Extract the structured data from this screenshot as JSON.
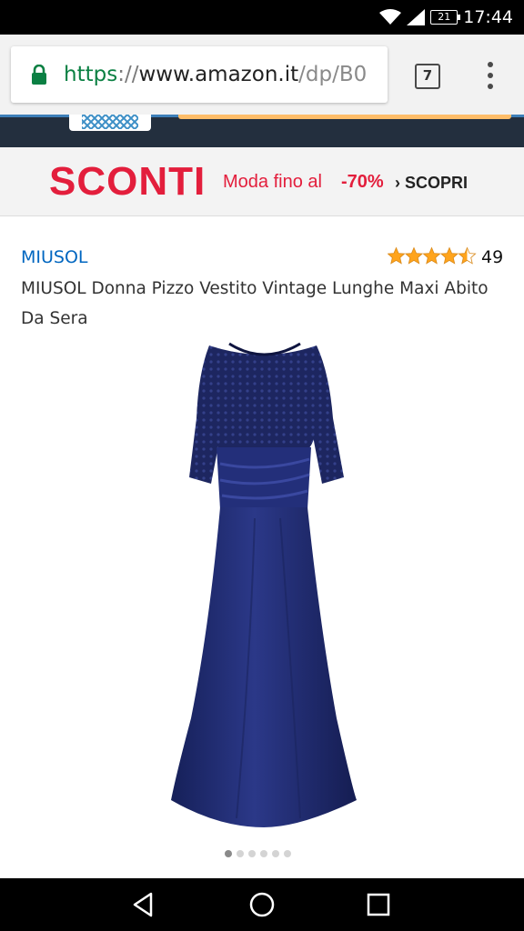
{
  "status_bar": {
    "time": "17:44",
    "battery_level": "21",
    "icons": [
      "wifi-icon",
      "signal-icon",
      "battery-icon"
    ]
  },
  "browser": {
    "url": {
      "scheme": "https",
      "separator": "://",
      "host": "www.amazon.it",
      "path": "/dp/B0"
    },
    "tab_count": "7",
    "icons": [
      "lock-icon",
      "tabs-icon",
      "overflow-menu-icon"
    ]
  },
  "promo_banner": {
    "headline": "SCONTI",
    "subtext": "Moda fino al",
    "discount": "-70%",
    "cta": "› SCOPRI"
  },
  "product": {
    "brand": "MIUSOL",
    "title": "MIUSOL Donna Pizzo Vestito Vintage Lunghe Maxi Abito Da Sera",
    "rating_stars": 4.5,
    "rating_count": "49",
    "image_description_icon": "dress-image",
    "carousel": {
      "total": 6,
      "active_index": 0
    }
  },
  "navigation_bar": {
    "icons": [
      "back-icon",
      "home-icon",
      "recents-icon"
    ]
  },
  "colors": {
    "amazon_header": "#232f3e",
    "brand_link": "#0066c0",
    "promo_red": "#e31e3c",
    "star": "#ffa41c",
    "dress": "#1f2a6b"
  }
}
